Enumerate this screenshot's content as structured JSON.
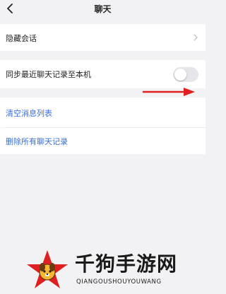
{
  "nav": {
    "title": "聊天",
    "back_icon": "chevron-left-icon"
  },
  "rows": {
    "hidden_chats": {
      "label": "隐藏会话",
      "icon": "chevron-right-icon"
    },
    "sync_recent": {
      "label": "同步最近聊天记录至本机",
      "toggle_on": false
    },
    "clear_list": {
      "label": "清空消息列表"
    },
    "delete_all": {
      "label": "删除所有聊天记录"
    }
  },
  "annotation": {
    "icon": "red-arrow-icon",
    "color": "#e02020"
  },
  "watermark": {
    "title": "千狗手游网",
    "subtitle": "QIANGOUSHOUYOUWANG",
    "logo_icon": "star-dog-mascot-icon"
  },
  "colors": {
    "background": "#f2f2f4",
    "link": "#3a6fd6",
    "toggle_off": "#e6e6ea",
    "accent_red": "#e02020"
  }
}
